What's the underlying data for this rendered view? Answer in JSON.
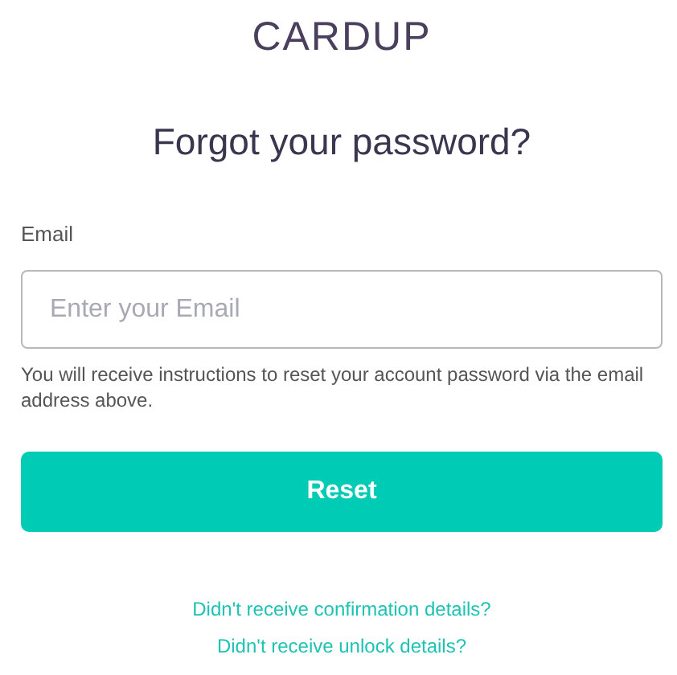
{
  "logo": "CARDUP",
  "title": "Forgot your password?",
  "email": {
    "label": "Email",
    "placeholder": "Enter your Email"
  },
  "help_text": "You will receive instructions to reset your account password via the email address above.",
  "submit_button": "Reset",
  "links": [
    "Didn't receive confirmation details?",
    "Didn't receive unlock details?"
  ]
}
